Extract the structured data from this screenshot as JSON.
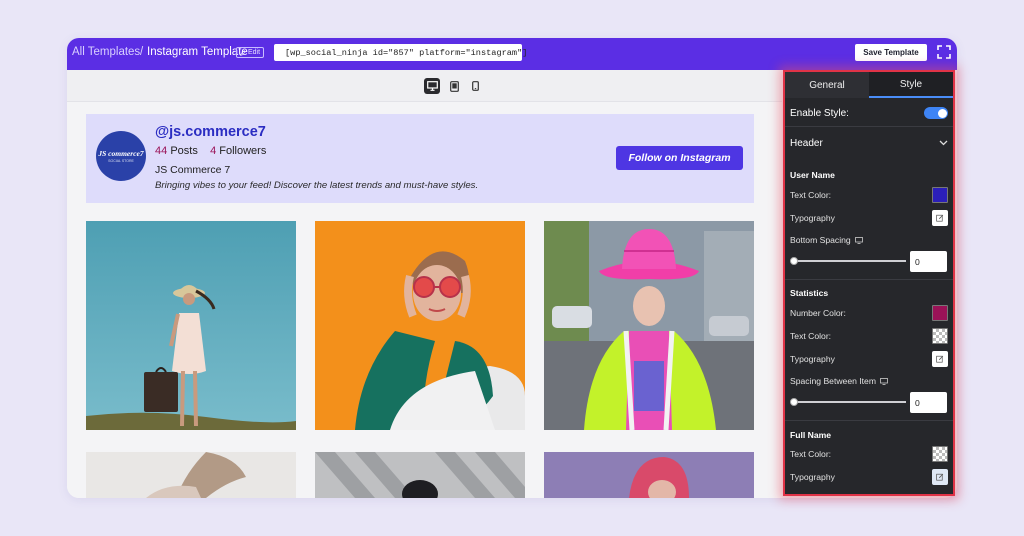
{
  "topbar": {
    "breadcrumb_all": "All Templates",
    "breadcrumb_sep": "/",
    "breadcrumb_current": "Instagram Template",
    "edit_label": "Edit",
    "shortcode": "[wp_social_ninja id=\"857\" platform=\"instagram\"]",
    "save_label": "Save Template"
  },
  "devices": [
    "desktop-icon",
    "tablet-icon",
    "mobile-icon"
  ],
  "profile": {
    "avatar_text": "JS commerce7",
    "avatar_sub": "SOCIAL STORE",
    "username": "@js.commerce7",
    "posts_count": "44",
    "posts_label": "Posts",
    "followers_count": "4",
    "followers_label": "Followers",
    "full_name": "JS Commerce 7",
    "bio": "Bringing vibes to your feed! Discover the latest trends and must-have styles.",
    "follow_label": "Follow on Instagram"
  },
  "panel": {
    "tabs": [
      {
        "label": "General"
      },
      {
        "label": "Style"
      }
    ],
    "enable_style_label": "Enable Style:",
    "header_label": "Header",
    "user_name": {
      "title": "User Name",
      "text_color_label": "Text Color:",
      "text_color": "#2b1fb8",
      "typography_label": "Typography",
      "bottom_spacing_label": "Bottom Spacing",
      "bottom_spacing_value": "0"
    },
    "statistics": {
      "title": "Statistics",
      "number_color_label": "Number Color:",
      "number_color": "#9a1257",
      "text_color_label": "Text Color:",
      "typography_label": "Typography",
      "spacing_label": "Spacing Between Item",
      "spacing_value": "0"
    },
    "full_name": {
      "title": "Full Name",
      "text_color_label": "Text Color:",
      "typography_label": "Typography"
    }
  },
  "colors": {
    "accent": "#5b2ee4",
    "follow_button": "#4e36e3",
    "username": "#2b2dc2",
    "panel_bg": "#26272b",
    "highlight": "#e03347",
    "toggle": "#3e84f5"
  }
}
